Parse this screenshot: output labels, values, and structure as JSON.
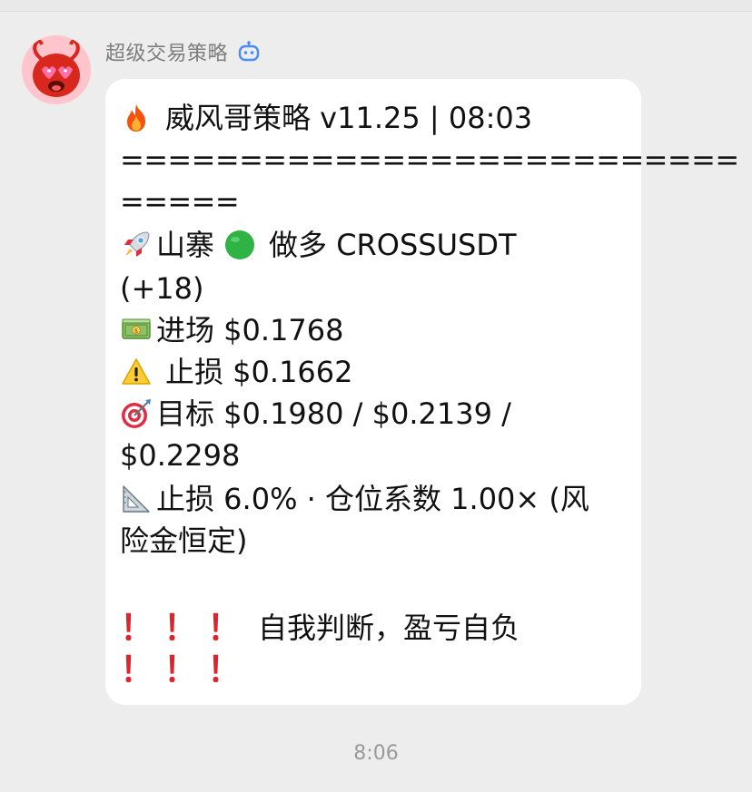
{
  "sender": {
    "name": "超级交易策略",
    "bot_icon": "robot-icon"
  },
  "message": {
    "title": "威风哥策略 v11.25 | 08:03",
    "separator_1": "==========================",
    "separator_2": "=====",
    "signal_line_a": "山寨",
    "signal_line_b": "做多 CROSSUSDT",
    "signal_line_c": "(+18)",
    "entry": "进场 $0.1768",
    "stop": "止损 $0.1662",
    "target_a": "目标 $0.1980 / $0.2139 /",
    "target_b": "$0.2298",
    "risk_a": "止损 6.0% · 仓位系数 1.00× (风",
    "risk_b": "险金恒定)",
    "warning_text": "自我判断，盈亏自负",
    "warning_mark": "！",
    "icons": [
      "fire-icon",
      "rocket-icon",
      "green-circle-icon",
      "money-icon",
      "warning-icon",
      "target-icon",
      "triangle-ruler-icon"
    ]
  },
  "timestamp": "8:06",
  "colors": {
    "background": "#ededed",
    "bubble": "#ffffff",
    "warning_red": "#e0242b",
    "bot_blue": "#4a8cf7"
  }
}
